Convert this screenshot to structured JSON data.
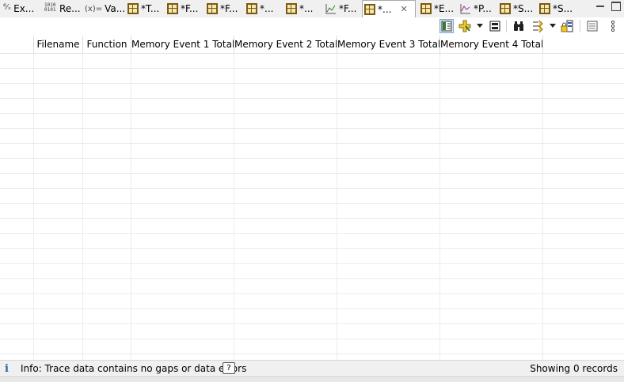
{
  "tabs": [
    {
      "label": "Ex...",
      "icon": "expressions-icon"
    },
    {
      "label": "Re...",
      "icon": "registers-icon"
    },
    {
      "label": "Va...",
      "icon": "variables-icon"
    },
    {
      "label": "*T...",
      "icon": "table-icon"
    },
    {
      "label": "*F...",
      "icon": "table-icon"
    },
    {
      "label": "*F...",
      "icon": "table-icon"
    },
    {
      "label": "*...",
      "icon": "table-icon"
    },
    {
      "label": "*...",
      "icon": "table-icon"
    },
    {
      "label": "*F...",
      "icon": "graph-icon"
    },
    {
      "label": "*...",
      "icon": "table-icon",
      "active": true
    },
    {
      "label": "*E...",
      "icon": "table-icon"
    },
    {
      "label": "*P...",
      "icon": "graph-icon"
    },
    {
      "label": "*S...",
      "icon": "table-icon"
    },
    {
      "label": "*S...",
      "icon": "table-icon"
    }
  ],
  "table": {
    "columns": [
      "",
      "Filename",
      "Function",
      "Memory Event 1 Total",
      "Memory Event 2 Total",
      "Memory Event 3 Total",
      "Memory Event 4 Total"
    ],
    "rows": []
  },
  "status": {
    "info_text": "Info: Trace data contains no gaps or data errors",
    "help_label": "?",
    "records_text": "Showing 0 records"
  }
}
